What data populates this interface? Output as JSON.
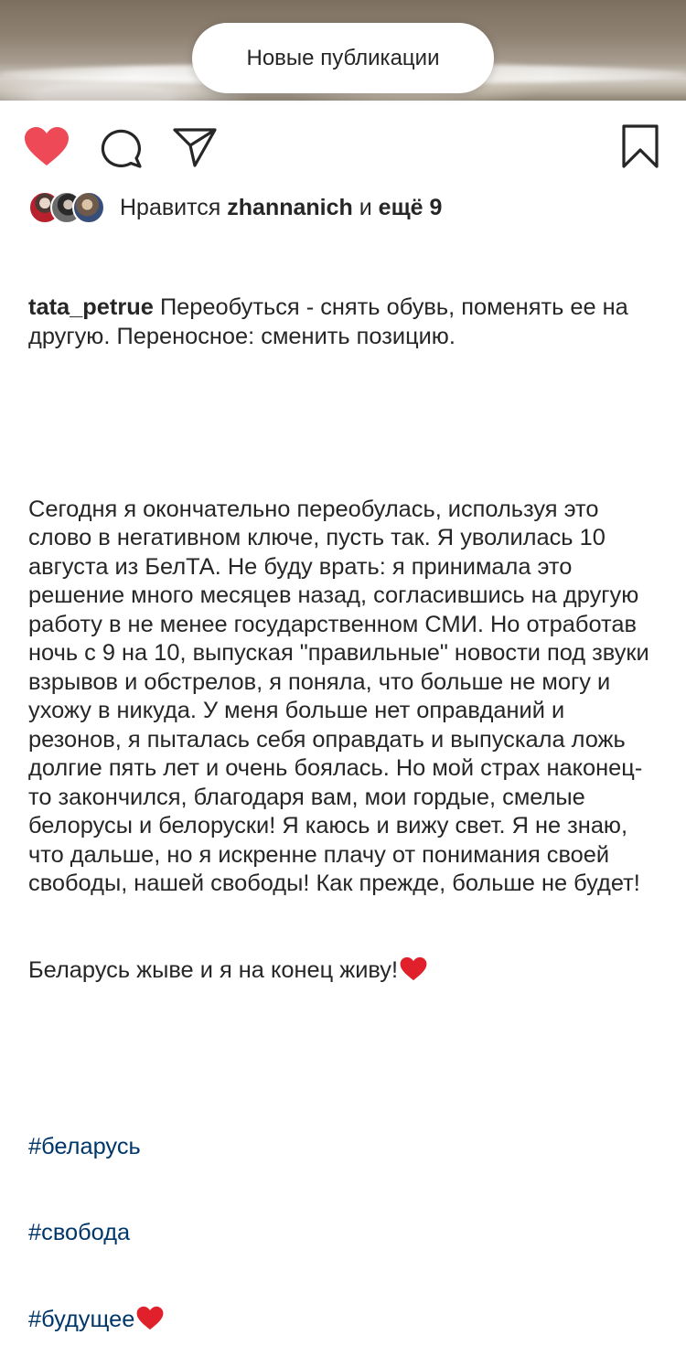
{
  "banner": {
    "label": "Новые публикации"
  },
  "actions": {
    "like_icon": "heart-filled-icon",
    "comment_icon": "comment-icon",
    "share_icon": "paper-plane-icon",
    "save_icon": "bookmark-icon",
    "like_color": "#ed4956"
  },
  "likes": {
    "prefix": "Нравится",
    "user": "zhannanich",
    "connector": "и",
    "others": "ещё 9"
  },
  "caption": {
    "username": "tata_petrue",
    "intro": "Переобуться - снять обувь, поменять ее на другую. Переносное: сменить позицию.",
    "body": "Сегодня я окончательно переобулась, используя это слово в негативном ключе, пусть так. Я уволилась 10 августа из БелТА. Не буду врать: я принимала это решение много месяцев назад, согласившись на другую работу в не менее государственном СМИ. Но отработав ночь с 9 на 10, выпуская \"правильные\" новости под звуки взрывов и обстрелов, я поняла, что больше не могу и ухожу в никуда. У меня больше нет оправданий и резонов, я пыталась себя оправдать и выпускала ложь долгие пять лет и очень боялась. Но мой страх наконец-то закончился, благодаря вам, мои гордые, смелые белорусы и белоруски! Я каюсь и вижу свет. Я не знаю, что дальше, но я искренне плачу от понимания своей свободы, нашей свободы! Как прежде, больше не будет!",
    "closing": "Беларусь жыве и я на конец живу!",
    "hashtags": [
      "#беларусь",
      "#свобода",
      "#будущее"
    ],
    "emoji": "red-heart-emoji"
  }
}
